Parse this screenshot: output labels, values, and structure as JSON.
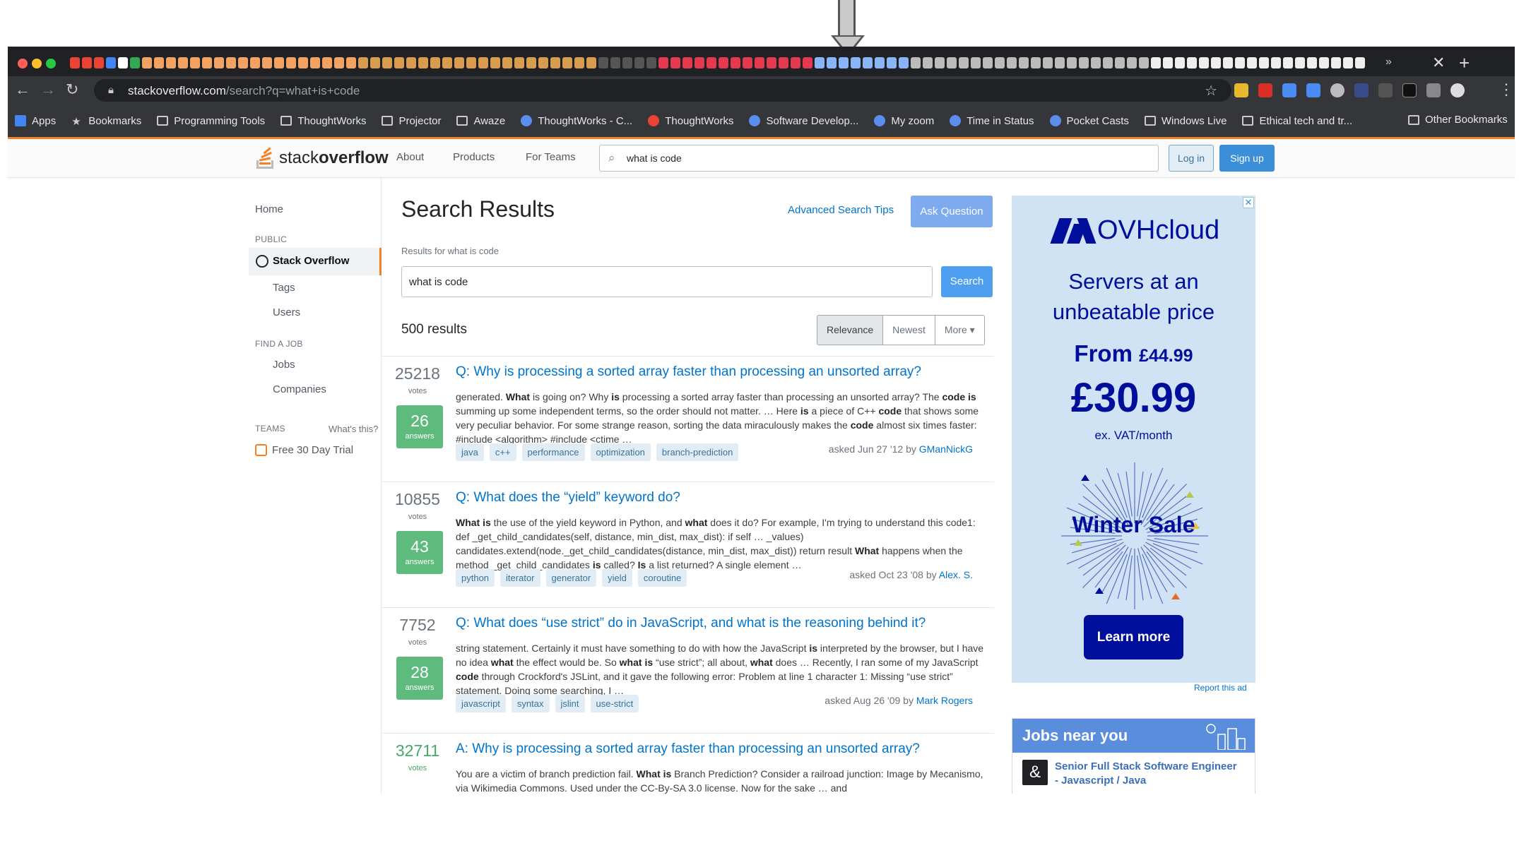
{
  "browser": {
    "url_host": "stackoverflow.com",
    "url_path": "/search?q=what+is+code",
    "bookmarks": [
      {
        "label": "Apps",
        "kind": "grid"
      },
      {
        "label": "Bookmarks",
        "kind": "star"
      },
      {
        "label": "Programming Tools",
        "kind": "folder"
      },
      {
        "label": "ThoughtWorks",
        "kind": "folder"
      },
      {
        "label": "Projector",
        "kind": "folder"
      },
      {
        "label": "Awaze",
        "kind": "folder"
      },
      {
        "label": "ThoughtWorks - C...",
        "kind": "site"
      },
      {
        "label": "ThoughtWorks",
        "kind": "gmail"
      },
      {
        "label": "Software Develop...",
        "kind": "site"
      },
      {
        "label": "My zoom",
        "kind": "site"
      },
      {
        "label": "Time in Status",
        "kind": "site"
      },
      {
        "label": "Pocket Casts",
        "kind": "site"
      },
      {
        "label": "Windows Live",
        "kind": "folder"
      },
      {
        "label": "Ethical tech and tr...",
        "kind": "folder"
      }
    ],
    "more_bookmarks": "»",
    "other_bookmarks": "Other Bookmarks"
  },
  "so_header": {
    "logo_light": "stack",
    "logo_bold": "overflow",
    "nav": [
      "About",
      "Products",
      "For Teams"
    ],
    "search_value": "what is code",
    "login_label": "Log in",
    "signup_label": "Sign up"
  },
  "left_nav": {
    "home": "Home",
    "public_heading": "PUBLIC",
    "stack_overflow": "Stack Overflow",
    "tags": "Tags",
    "users": "Users",
    "find_job_heading": "FIND A JOB",
    "jobs": "Jobs",
    "companies": "Companies",
    "teams_heading": "TEAMS",
    "whats_this": "What's this?",
    "free_trial": "Free 30 Day Trial"
  },
  "main": {
    "title": "Search Results",
    "advanced_tips": "Advanced Search Tips",
    "ask_question": "Ask Question",
    "results_for": "Results for what is code",
    "search_value": "what is code",
    "search_button": "Search",
    "result_count": "500 results",
    "sort_options": [
      "Relevance",
      "Newest",
      "More ▾"
    ],
    "selected_sort": "Relevance",
    "results": [
      {
        "votes": "25218",
        "votes_label": "votes",
        "answers": "26",
        "answers_label": "answers",
        "title": "Q: Why is processing a sorted array faster than processing an unsorted array?",
        "excerpt_html": "generated. <b>What</b> is going on? Why <b>is</b> processing a sorted array faster than processing an unsorted array? The <b>code is</b> summing up some independent terms, so the order should not matter. … Here <b>is</b> a piece of C++ <b>code</b> that shows some very peculiar behavior. For some strange reason, sorting the data miraculously makes the <b>code</b> almost six times faster: #include &lt;algorithm&gt; #include &lt;ctime …",
        "tags": [
          "java",
          "c++",
          "performance",
          "optimization",
          "branch-prediction"
        ],
        "asked": "asked Jun 27 '12 by",
        "user": "GManNickG"
      },
      {
        "votes": "10855",
        "votes_label": "votes",
        "answers": "43",
        "answers_label": "answers",
        "title": "Q: What does the “yield” keyword do?",
        "excerpt_html": "<b>What is</b> the use of the yield keyword in Python, and <b>what</b> does it do? For example, I'm trying to understand this code1: def _get_child_candidates(self, distance, min_dist, max_dist): if self … _values) candidates.extend(node._get_child_candidates(distance, min_dist, max_dist)) return result <b>What</b> happens when the method _get_child_candidates <b>is</b> called? <b>Is</b> a list returned? A single element …",
        "tags": [
          "python",
          "iterator",
          "generator",
          "yield",
          "coroutine"
        ],
        "asked": "asked Oct 23 '08 by",
        "user": "Alex. S."
      },
      {
        "votes": "7752",
        "votes_label": "votes",
        "answers": "28",
        "answers_label": "answers",
        "title": "Q: What does “use strict” do in JavaScript, and what is the reasoning behind it?",
        "excerpt_html": "string statement. Certainly it must have something to do with how the JavaScript <b>is</b> interpreted by the browser, but I have no idea <b>what</b> the effect would be. So <b>what is</b> “use strict”; all about, <b>what</b> does … Recently, I ran some of my JavaScript <b>code</b> through Crockford's JSLint, and it gave the following error: Problem at line 1 character 1: Missing “use strict” statement. Doing some searching, I …",
        "tags": [
          "javascript",
          "syntax",
          "jslint",
          "use-strict"
        ],
        "asked": "asked Aug 26 '09 by",
        "user": "Mark Rogers"
      },
      {
        "votes": "32711",
        "votes_label": "votes",
        "title": "A: Why is processing a sorted array faster than processing an unsorted array?",
        "excerpt_html": "You are a victim of branch prediction fail. <b>What is</b> Branch Prediction? Consider a railroad junction: Image by Mecanismo, via Wikimedia Commons. Used under the CC-By-SA 3.0 license. Now for the sake … and"
      }
    ]
  },
  "ad": {
    "brand": "OVHcloud",
    "headline_1": "Servers at an",
    "headline_2": "unbeatable price",
    "from_label": "From",
    "from_price": "£44.99",
    "price": "£30.99",
    "vat": "ex. VAT/month",
    "winter_sale": "Winter Sale",
    "cta": "Learn more",
    "report": "Report this ad",
    "close": "✕",
    "brand_color": "#000e9c"
  },
  "jobs": {
    "heading": "Jobs near you",
    "job_title": "Senior Full Stack Software Engineer - Javascript / Java",
    "logo_glyph": "&"
  },
  "colors": {
    "so_orange": "#f48024",
    "link_blue": "#0074cc",
    "answered_green": "#5eba7d"
  }
}
